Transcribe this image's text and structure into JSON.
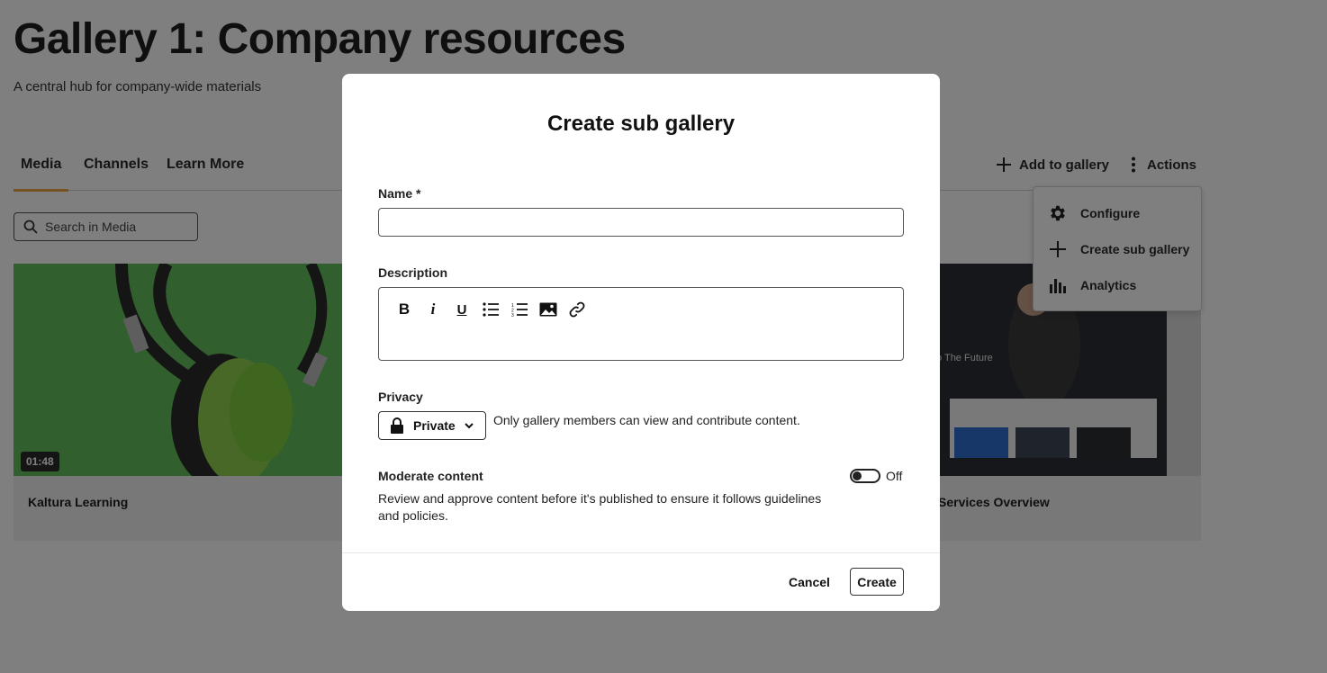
{
  "page": {
    "title": "Gallery 1: Company resources",
    "subtitle": "A central hub for company-wide materials",
    "tabs": [
      {
        "label": "Media",
        "active": true
      },
      {
        "label": "Channels"
      },
      {
        "label": "Learn More"
      }
    ],
    "add_to_gallery_label": "Add to gallery",
    "actions_label": "Actions",
    "search_placeholder": "Search in Media",
    "cards": [
      {
        "title": "Kaltura Learning",
        "duration": "01:48"
      },
      {
        "title": "Services Overview",
        "thumb_text": "o The Future"
      }
    ]
  },
  "actions_menu": {
    "items": [
      {
        "label": "Configure",
        "icon": "gear-icon"
      },
      {
        "label": "Create sub gallery",
        "icon": "plus-icon"
      },
      {
        "label": "Analytics",
        "icon": "bar-chart-icon"
      }
    ]
  },
  "modal": {
    "title": "Create sub gallery",
    "name_label": "Name *",
    "name_value": "",
    "description_label": "Description",
    "privacy_label": "Privacy",
    "privacy_value": "Private",
    "privacy_help": "Only gallery members can view and contribute content.",
    "moderate_label": "Moderate content",
    "moderate_state": "Off",
    "moderate_help": "Review and approve content before it's published to ensure it follows guidelines and policies.",
    "cancel_label": "Cancel",
    "create_label": "Create"
  },
  "colors": {
    "tab_underline": "#e8a33d",
    "overlay": "rgba(0,0,0,0.5)"
  }
}
